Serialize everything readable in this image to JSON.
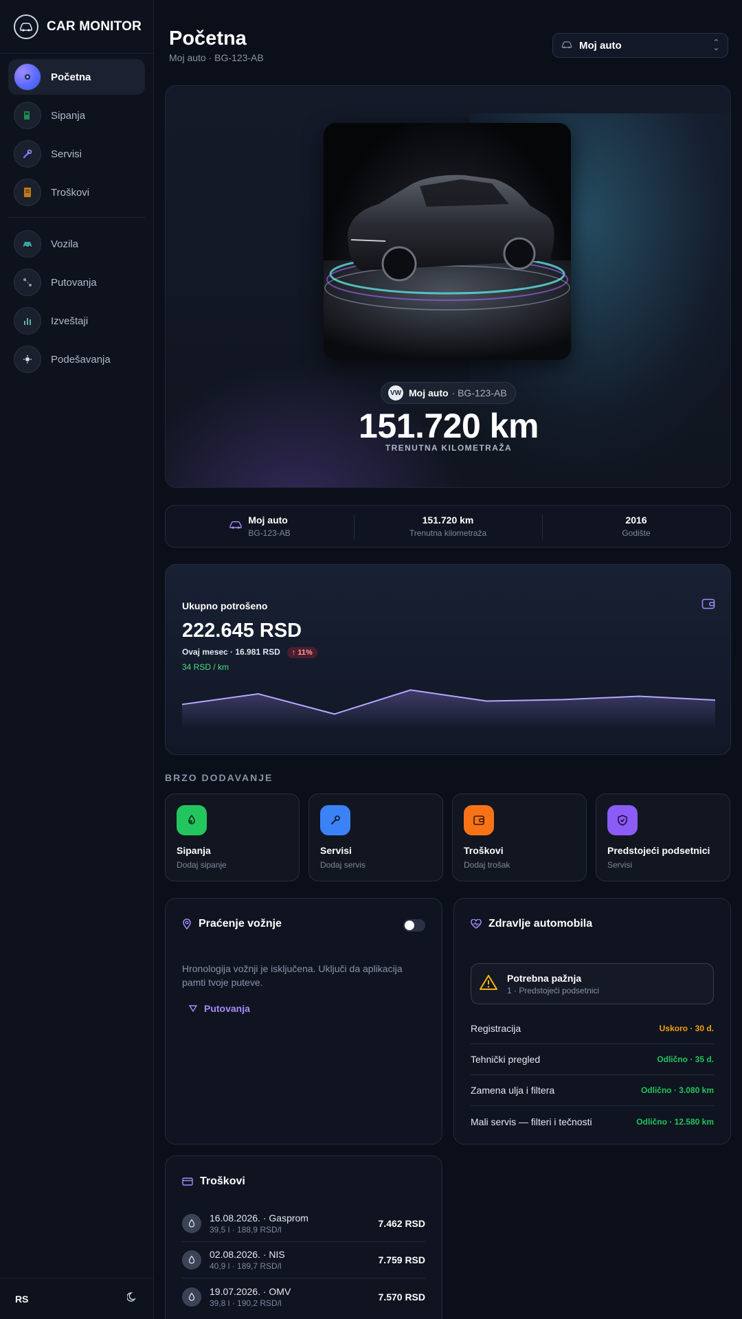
{
  "sidebar": {
    "brand": "CAR MONITOR",
    "items": [
      {
        "label": "Početna",
        "icon": "dashboard-icon",
        "active": true
      },
      {
        "label": "Sipanja",
        "icon": "fuel-icon"
      },
      {
        "label": "Servisi",
        "icon": "wrench-icon"
      },
      {
        "label": "Troškovi",
        "icon": "receipt-icon"
      },
      {
        "label": "Vozila",
        "icon": "car-icon"
      },
      {
        "label": "Putovanja",
        "icon": "route-icon"
      },
      {
        "label": "Izveštaji",
        "icon": "chart-icon"
      },
      {
        "label": "Podešavanja",
        "icon": "settings-icon"
      }
    ],
    "language": "RS",
    "theme_icon": "moon-icon"
  },
  "header": {
    "title": "Početna",
    "subtitle": "Moj auto · BG-123-AB",
    "car_select": "Moj auto"
  },
  "hero": {
    "car_name": "Moj auto",
    "plate": "· BG-123-AB",
    "mileage": "151.720 km",
    "mileage_label": "TRENUTNA KILOMETRAŽA"
  },
  "stats": [
    {
      "value": "Moj auto",
      "sub": "BG-123-AB"
    },
    {
      "value": "151.720 km",
      "sub": "Trenutna kilometraža"
    },
    {
      "value": "2016",
      "sub": "Godište"
    }
  ],
  "spending": {
    "label": "Ukupno potrošeno",
    "amount": "222.645 RSD",
    "month": "Ovaj mesec · 16.981 RSD",
    "change": "↑ 11%",
    "per_km": "34 RSD / km",
    "trend": [
      38,
      60,
      18,
      68,
      45,
      48,
      55,
      47
    ]
  },
  "quick_add": {
    "title": "BRZO DODAVANJE",
    "items": [
      {
        "title": "Sipanja",
        "sub": "Dodaj sipanje",
        "color": "#22c55e",
        "icon": "fuel-drop-icon"
      },
      {
        "title": "Servisi",
        "sub": "Dodaj servis",
        "color": "#3b82f6",
        "icon": "wrench-icon"
      },
      {
        "title": "Troškovi",
        "sub": "Dodaj trošak",
        "color": "#f97316",
        "icon": "wallet-icon"
      },
      {
        "title": "Predstojeći podsetnici",
        "sub": "Servisi",
        "color": "#8b5cf6",
        "icon": "shield-icon"
      }
    ]
  },
  "tracking": {
    "title": "Praćenje vožnje",
    "text": "Hronologija vožnji je isključena. Uključi da aplikacija pamti tvoje puteve.",
    "link": "Putovanja",
    "enabled": false
  },
  "health": {
    "title": "Zdravlje automobila",
    "alert_title": "Potrebna pažnja",
    "alert_sub": "1 · Predstojeći podsetnici",
    "rows": [
      {
        "label": "Registracija",
        "value": "Uskoro · 30 d.",
        "color": "#f59e0b"
      },
      {
        "label": "Tehnički pregled",
        "value": "Odlično · 35 d.",
        "color": "#22c55e"
      },
      {
        "label": "Zamena ulja i filtera",
        "value": "Odlično · 3.080 km",
        "color": "#22c55e"
      },
      {
        "label": "Mali servis — filteri i tečnosti",
        "value": "Odlično · 12.580 km",
        "color": "#22c55e"
      }
    ]
  },
  "expenses": {
    "title": "Troškovi",
    "rows": [
      {
        "main": "16.08.2026. · Gasprom",
        "sub": "39,5 l · 188,9 RSD/l",
        "amount": "7.462 RSD"
      },
      {
        "main": "02.08.2026. · NIS",
        "sub": "40,9 l · 189,7 RSD/l",
        "amount": "7.759 RSD"
      },
      {
        "main": "19.07.2026. · OMV",
        "sub": "39,8 l · 190,2 RSD/l",
        "amount": "7.570 RSD"
      }
    ]
  }
}
